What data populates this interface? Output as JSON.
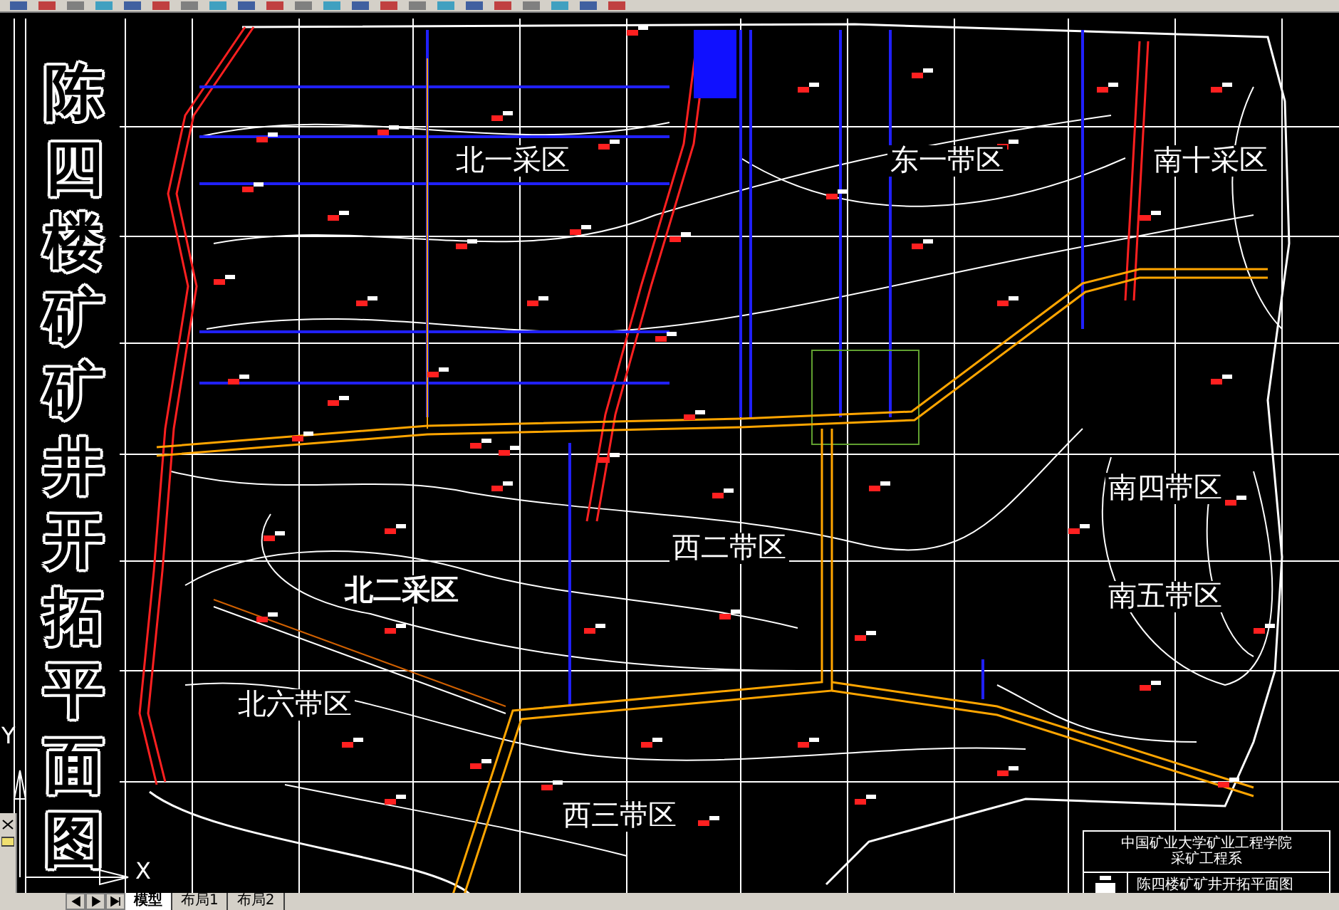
{
  "drawing_title": "陈四楼矿矿井开拓平面图",
  "regions": [
    {
      "label": "北一采区",
      "emphasis": false
    },
    {
      "label": "东一带区",
      "emphasis": false
    },
    {
      "label": "南十采区",
      "emphasis": false
    },
    {
      "label": "南四带区",
      "emphasis": false
    },
    {
      "label": "西二带区",
      "emphasis": false
    },
    {
      "label": "北二采区",
      "emphasis": true
    },
    {
      "label": "南五带区",
      "emphasis": false
    },
    {
      "label": "北六带区",
      "emphasis": false
    },
    {
      "label": "西三带区",
      "emphasis": false
    }
  ],
  "ucs": {
    "x": "X",
    "y": "Y"
  },
  "title_block": {
    "school": "中国矿业大学矿业工程学院",
    "department": "采矿工程系",
    "title": "陈四楼矿矿井开拓平面图"
  },
  "layout_tabs": [
    {
      "label": "模型",
      "selected": true
    },
    {
      "label": "布局1",
      "selected": false
    },
    {
      "label": "布局2",
      "selected": false
    }
  ]
}
